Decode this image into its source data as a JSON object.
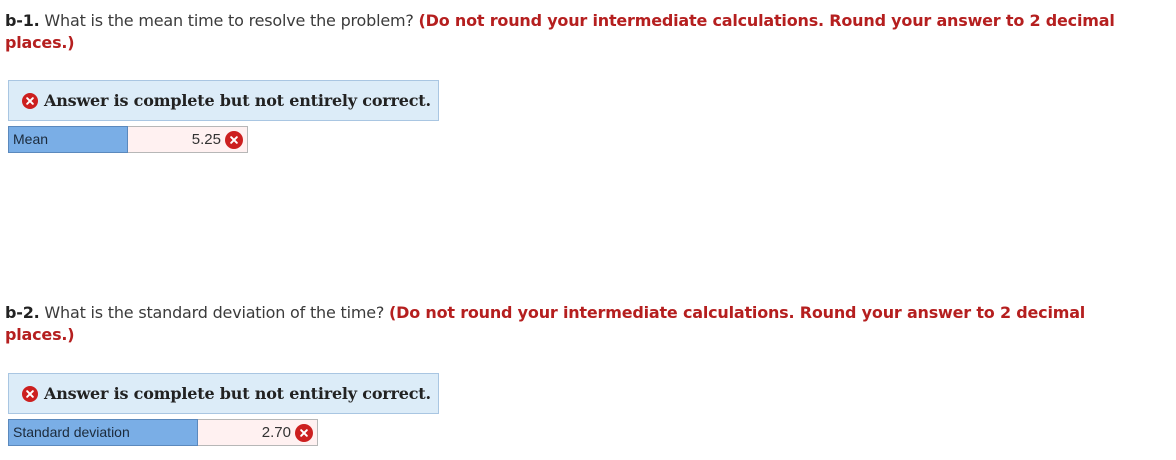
{
  "questions": [
    {
      "number": "b-1.",
      "prompt": " What is the mean time to resolve the problem? ",
      "instruction": "(Do not round your intermediate calculations. Round your answer to 2 decimal places.)",
      "feedback": "Answer is complete but not entirely correct.",
      "answer_label": "Mean",
      "answer_value": "5.25",
      "answer_status": "incorrect"
    },
    {
      "number": "b-2.",
      "prompt": " What is the standard deviation of the time? ",
      "instruction": "(Do not round your intermediate calculations. Round your answer to 2 decimal places.)",
      "feedback": "Answer is complete but not entirely correct.",
      "answer_label": "Standard deviation",
      "answer_value": "2.70",
      "answer_status": "incorrect"
    }
  ],
  "icons": {
    "feedback_icon": "x-circle-icon",
    "incorrect_icon": "x-circle-icon"
  },
  "colors": {
    "instruction": "#b51f1f",
    "error_icon": "#cc1f1f",
    "banner_bg": "#dcecf8",
    "label_bg": "#7aaee6",
    "input_bg": "#fff1f1"
  }
}
